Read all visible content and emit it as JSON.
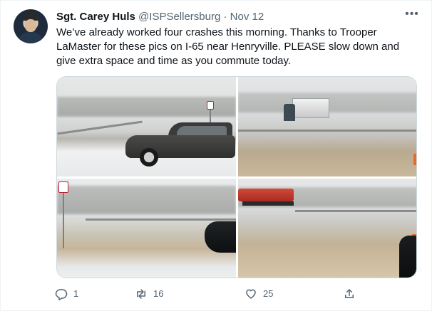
{
  "tweet": {
    "author_name": "Sgt. Carey Huls",
    "author_handle": "@ISPSellersburg",
    "separator": "·",
    "date": "Nov 12",
    "more_label": "•••",
    "text": "We’ve already worked four crashes this morning. Thanks to Trooper LaMaster for these pics on I-65 near Henryville. PLEASE slow down and give extra space and time as you commute today."
  },
  "media": {
    "photo_count": 4
  },
  "actions": {
    "reply_icon": "reply-icon",
    "reply_count": "1",
    "retweet_icon": "retweet-icon",
    "retweet_count": "16",
    "like_icon": "heart-icon",
    "like_count": "25",
    "share_icon": "share-icon"
  },
  "colors": {
    "text_primary": "#0f1419",
    "text_secondary": "#536471",
    "border": "#cfd9de"
  }
}
